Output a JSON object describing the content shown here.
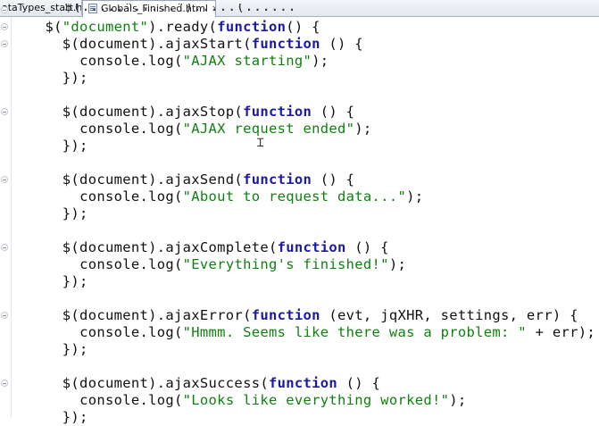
{
  "tabs": [
    {
      "label": "ataTypes_start.html"
    },
    {
      "label": "Globals_Finished.html"
    }
  ],
  "code": {
    "partial_top": "$(.....\".....\").....(......",
    "lines": [
      {
        "indent": "    ",
        "pre": "$(",
        "str": "\"document\"",
        "mid": ").ready(",
        "kw": "function",
        "post": "() {"
      },
      {
        "indent": "      ",
        "pre": "$(document).ajaxStart(",
        "kw": "function",
        "post": " () {"
      },
      {
        "indent": "        ",
        "pre": "console.log(",
        "str": "\"AJAX starting\"",
        "post": ");"
      },
      {
        "indent": "      ",
        "pre": "});"
      },
      {
        "indent": "",
        "pre": ""
      },
      {
        "indent": "      ",
        "pre": "$(document).ajaxStop(",
        "kw": "function",
        "post": " () {"
      },
      {
        "indent": "        ",
        "pre": "console.log(",
        "str": "\"AJAX request ended\"",
        "post": ");"
      },
      {
        "indent": "      ",
        "pre": "});"
      },
      {
        "indent": "",
        "pre": ""
      },
      {
        "indent": "      ",
        "pre": "$(document).ajaxSend(",
        "kw": "function",
        "post": " () {"
      },
      {
        "indent": "        ",
        "pre": "console.log(",
        "str": "\"About to request data...\"",
        "post": ");"
      },
      {
        "indent": "      ",
        "pre": "});"
      },
      {
        "indent": "",
        "pre": ""
      },
      {
        "indent": "      ",
        "pre": "$(document).ajaxComplete(",
        "kw": "function",
        "post": " () {"
      },
      {
        "indent": "        ",
        "pre": "console.log(",
        "str": "\"Everything's finished!\"",
        "post": ");"
      },
      {
        "indent": "      ",
        "pre": "});"
      },
      {
        "indent": "",
        "pre": ""
      },
      {
        "indent": "      ",
        "pre": "$(document).ajaxError(",
        "kw": "function",
        "post": " (evt, jqXHR, settings, err) {"
      },
      {
        "indent": "        ",
        "pre": "console.log(",
        "str": "\"Hmmm. Seems like there was a problem: \"",
        "post": " + err);"
      },
      {
        "indent": "      ",
        "pre": "});"
      },
      {
        "indent": "",
        "pre": ""
      },
      {
        "indent": "      ",
        "pre": "$(document).ajaxSuccess(",
        "kw": "function",
        "post": " () {"
      },
      {
        "indent": "        ",
        "pre": "console.log(",
        "str": "\"Looks like everything worked!\"",
        "post": ");"
      },
      {
        "indent": "      ",
        "pre": "});"
      }
    ]
  },
  "colors": {
    "keyword": "#1a1aa6",
    "string": "#118011",
    "text": "#111111"
  }
}
